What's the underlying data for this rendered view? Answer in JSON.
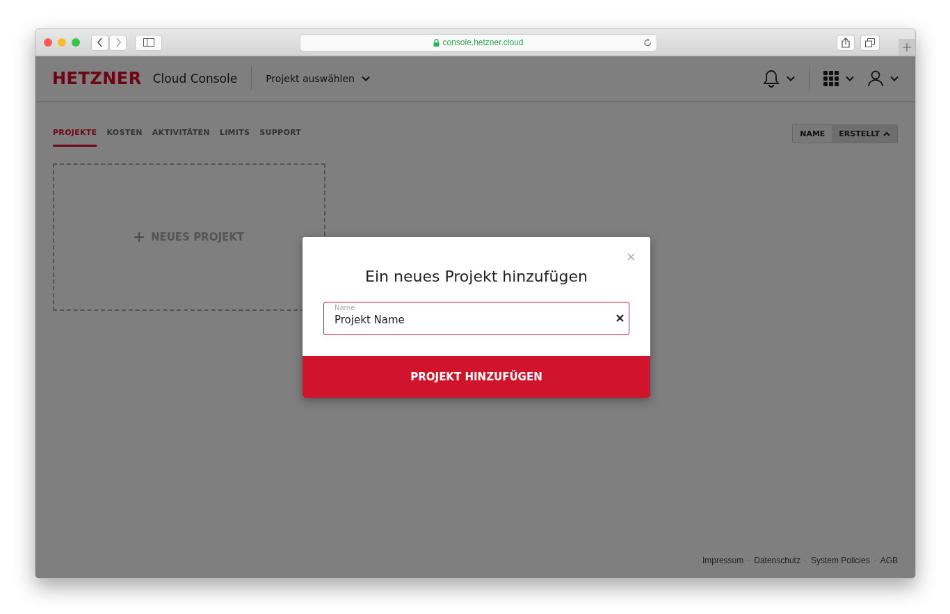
{
  "browser": {
    "url": "console.hetzner.cloud"
  },
  "header": {
    "logo": "HETZNER",
    "product": "Cloud Console",
    "project_select": "Projekt auswählen"
  },
  "tabs": [
    {
      "label": "PROJEKTE",
      "selected": true
    },
    {
      "label": "KOSTEN",
      "selected": false
    },
    {
      "label": "AKTIVITÄTEN",
      "selected": false
    },
    {
      "label": "LIMITS",
      "selected": false
    },
    {
      "label": "SUPPORT",
      "selected": false
    }
  ],
  "sort": [
    {
      "label": "NAME",
      "selected": false
    },
    {
      "label": "ERSTELLT",
      "selected": true
    }
  ],
  "new_project": {
    "label": "NEUES PROJEKT"
  },
  "modal": {
    "title": "Ein neues Projekt hinzufügen",
    "field": {
      "label": "Name",
      "value": "Projekt Name"
    },
    "submit": "PROJEKT HINZUFÜGEN"
  },
  "footer": [
    {
      "kind": "link",
      "text": "Impressum"
    },
    {
      "kind": "separator",
      "text": "·"
    },
    {
      "kind": "link",
      "text": "Datenschutz"
    },
    {
      "kind": "separator",
      "text": "·"
    },
    {
      "kind": "link",
      "text": "System Policies"
    },
    {
      "kind": "separator",
      "text": "·"
    },
    {
      "kind": "link",
      "text": "AGB"
    }
  ]
}
